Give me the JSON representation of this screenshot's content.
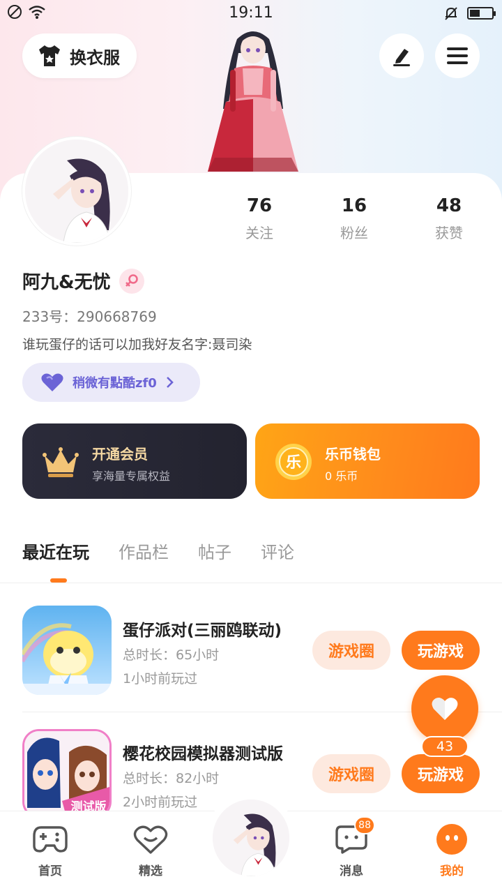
{
  "status_bar": {
    "time": "19:11"
  },
  "header": {
    "outfit_label": "换衣服"
  },
  "profile": {
    "name": "阿九&无忧",
    "uid": "233号：290668769",
    "bio": "谁玩蛋仔的话可以加我好友名字:聂司染",
    "tag": "稍微有點酷zf0",
    "stats": [
      {
        "value": "76",
        "label": "关注"
      },
      {
        "value": "16",
        "label": "粉丝"
      },
      {
        "value": "48",
        "label": "获赞"
      }
    ]
  },
  "cards": {
    "vip": {
      "title": "开通会员",
      "subtitle": "享海量专属权益"
    },
    "wallet": {
      "title": "乐币钱包",
      "subtitle": "0 乐币",
      "coin_char": "乐"
    }
  },
  "tabs": [
    "最近在玩",
    "作品栏",
    "帖子",
    "评论"
  ],
  "games": [
    {
      "title": "蛋仔派对(三丽鸥联动)",
      "duration": "总时长：65小时",
      "last_played": "1小时前玩过",
      "circle_label": "游戏圈",
      "play_label": "玩游戏"
    },
    {
      "title": "樱花校园模拟器测试版",
      "duration": "总时长：82小时",
      "last_played": "2小时前玩过",
      "circle_label": "游戏圈",
      "play_label": "玩游戏",
      "icon_badge": "测试版"
    }
  ],
  "fab": {
    "count": "43"
  },
  "bottom_nav": [
    {
      "label": "首页",
      "icon": "gamepad-icon"
    },
    {
      "label": "精选",
      "icon": "heart-chat-icon"
    },
    {
      "label": "消息",
      "icon": "message-icon",
      "badge": "88"
    },
    {
      "label": "我的",
      "icon": "profile-face-icon"
    }
  ],
  "colors": {
    "accent": "#ff7a1c",
    "vip_gold": "#f6d9a3",
    "tag_purple": "#6b63d6"
  }
}
